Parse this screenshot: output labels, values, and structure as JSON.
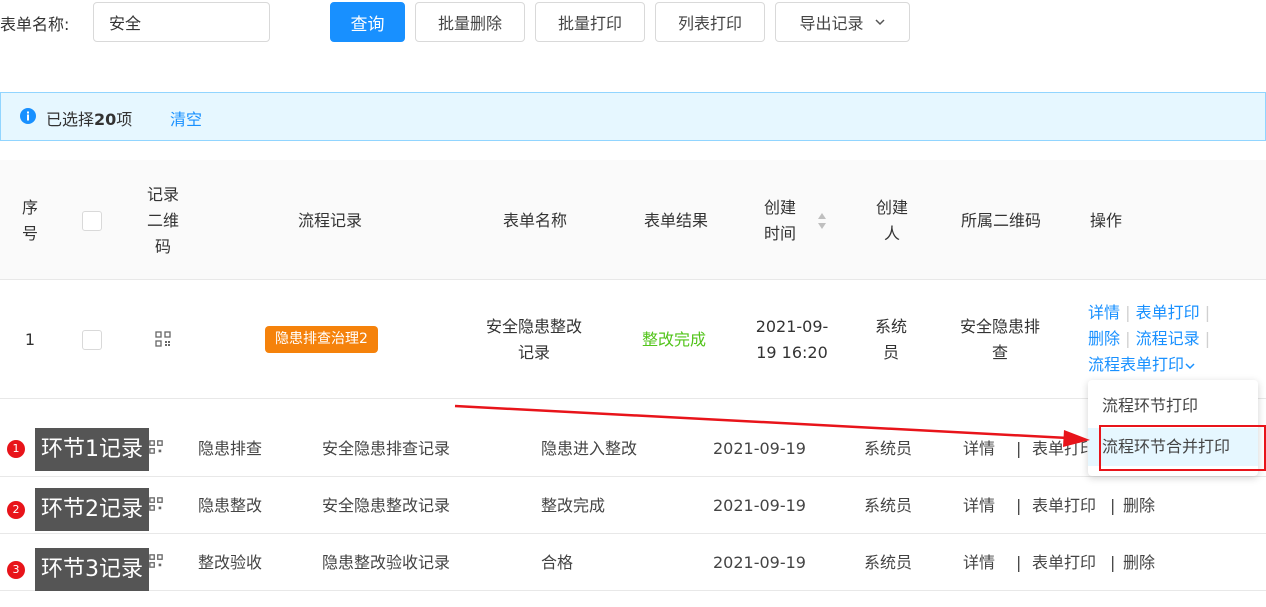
{
  "filter": {
    "label": "表单名称:",
    "value": "安全",
    "query_button": "查询",
    "batch_delete": "批量删除",
    "batch_print": "批量打印",
    "list_print": "列表打印",
    "export": "导出记录"
  },
  "selection": {
    "prefix": "已选择",
    "count": "20",
    "suffix": "项",
    "clear": "清空"
  },
  "headers": {
    "index": [
      "序",
      "号"
    ],
    "qrcode": [
      "记录",
      "二维",
      "码"
    ],
    "flow": "流程记录",
    "form_name": "表单名称",
    "form_result": "表单结果",
    "created_time": [
      "创建",
      "时间"
    ],
    "creator": [
      "创建",
      "人"
    ],
    "belong_qr": "所属二维码",
    "actions": "操作"
  },
  "main_row": {
    "index": "1",
    "flow_tag": "隐患排查治理2",
    "form_name": [
      "安全隐患整改",
      "记录"
    ],
    "result": "整改完成",
    "created": [
      "2021-09-",
      "19 16:20"
    ],
    "creator": [
      "系统",
      "员"
    ],
    "belong_qr": [
      "安全隐患排",
      "查"
    ],
    "actions": {
      "detail": "详情",
      "form_print": "表单打印",
      "delete": "删除",
      "flow_record": "流程记录",
      "flow_form_print": "流程表单打印"
    }
  },
  "dropdown": {
    "item1": "流程环节打印",
    "item2": "流程环节合并打印"
  },
  "sub_rows": [
    {
      "badge": "1",
      "tip": "环节1记录",
      "node": "隐患排查",
      "form": "安全隐患排查记录",
      "result": "隐患进入整改",
      "date": "2021-09-19",
      "creator": "系统员",
      "detail": "详情",
      "print": "表单打印",
      "delete": ""
    },
    {
      "badge": "2",
      "tip": "环节2记录",
      "node": "隐患整改",
      "form": "安全隐患整改记录",
      "result": "整改完成",
      "date": "2021-09-19",
      "creator": "系统员",
      "detail": "详情",
      "print": "表单打印",
      "delete": "删除"
    },
    {
      "badge": "3",
      "tip": "环节3记录",
      "node": "整改验收",
      "form": "隐患整改验收记录",
      "result": "合格",
      "date": "2021-09-19",
      "creator": "系统员",
      "detail": "详情",
      "print": "表单打印",
      "delete": "删除"
    }
  ],
  "colors": {
    "primary": "#1890ff",
    "tag_orange": "#f5820b",
    "result_green": "#52c41a",
    "annotation_red": "#e8141a"
  }
}
